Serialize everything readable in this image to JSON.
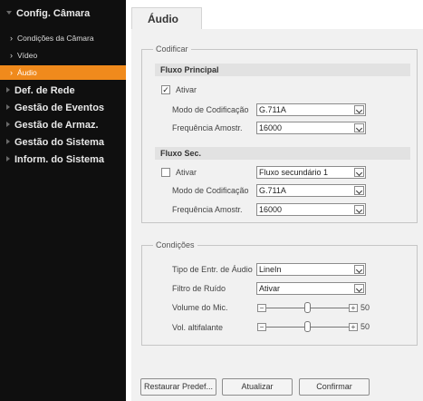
{
  "sidebar": {
    "sections": [
      {
        "label": "Config. Câmara",
        "expanded": true
      },
      {
        "label": "Def. de Rede"
      },
      {
        "label": "Gestão de Eventos"
      },
      {
        "label": "Gestão de Armaz."
      },
      {
        "label": "Gestão do Sistema"
      },
      {
        "label": "Inform. do Sistema"
      }
    ],
    "subitems": [
      {
        "label": "Condições da Câmara"
      },
      {
        "label": "Vídeo"
      },
      {
        "label": "Áudio",
        "active": true
      }
    ],
    "colors": {
      "background": "#0f0f0f",
      "active": "#f08a1c"
    }
  },
  "tab": {
    "title": "Áudio"
  },
  "codificar": {
    "legend": "Codificar",
    "main_stream": {
      "title": "Fluxo Principal",
      "enable_label": "Ativar",
      "enable_checked": true,
      "enable_mark": "✓",
      "codec_label": "Modo de Codificação",
      "codec_value": "G.711A",
      "freq_label": "Frequência Amostr.",
      "freq_value": "16000"
    },
    "sub_stream": {
      "title": "Fluxo Sec.",
      "enable_label": "Ativar",
      "enable_checked": false,
      "stream_value": "Fluxo secundário 1",
      "codec_label": "Modo de Codificação",
      "codec_value": "G.711A",
      "freq_label": "Frequência Amostr.",
      "freq_value": "16000"
    }
  },
  "conditions": {
    "legend": "Condições",
    "input_type_label": "Tipo de Entr. de Áudio",
    "input_type_value": "LineIn",
    "noise_filter_label": "Filtro de Ruído",
    "noise_filter_value": "Ativar",
    "mic_volume_label": "Volume do Mic.",
    "mic_volume_value": 50,
    "speaker_volume_label": "Vol. altifalante",
    "speaker_volume_value": 50,
    "minus_glyph": "−",
    "plus_glyph": "+"
  },
  "footer": {
    "default_label": "Restaurar Predef...",
    "refresh_label": "Atualizar",
    "confirm_label": "Confirmar"
  }
}
